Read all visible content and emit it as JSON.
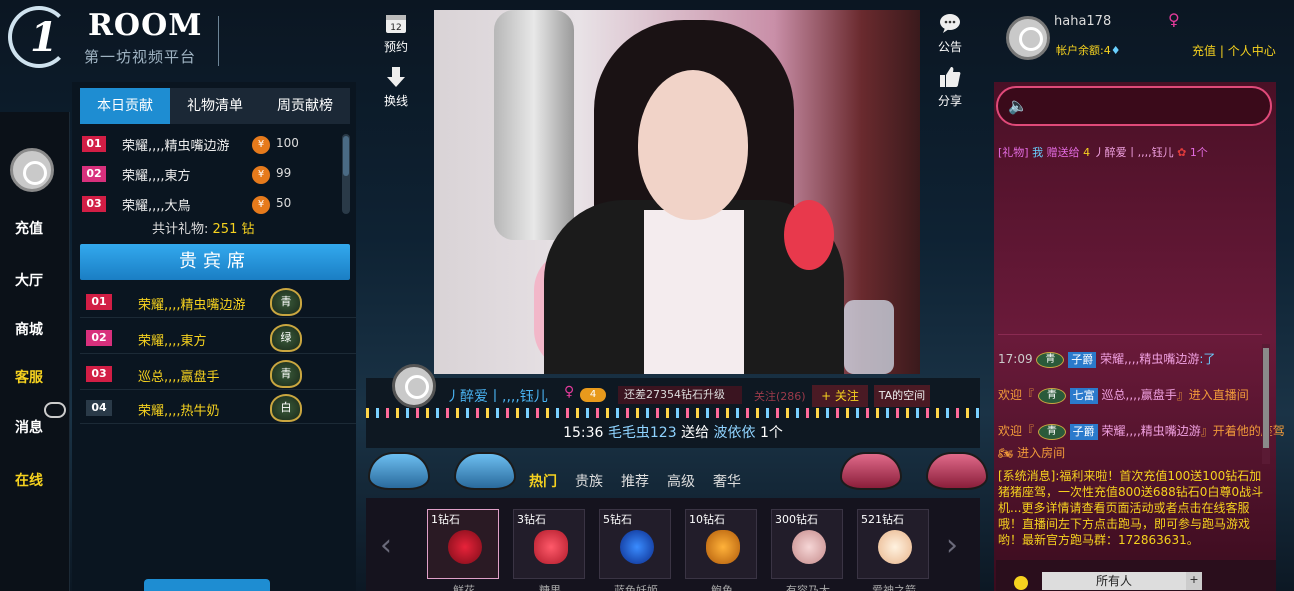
{
  "logo": {
    "mark": "1",
    "name": "ROOM",
    "subtitle": "第一坊视频平台"
  },
  "leftnav": {
    "items": [
      "充值",
      "大厅",
      "商城",
      "客服",
      "消息",
      "在线"
    ]
  },
  "contrib": {
    "tabs": [
      "本日贡献",
      "礼物清单",
      "周贡献榜"
    ],
    "rows": [
      {
        "rank": "01",
        "name": "荣耀,,,,精虫嘴边游",
        "value": "100"
      },
      {
        "rank": "02",
        "name": "荣耀,,,,東方",
        "value": "99"
      },
      {
        "rank": "03",
        "name": "荣耀,,,,大鳥",
        "value": "50"
      }
    ],
    "total_label": "共计礼物:",
    "total_value": "251 钻",
    "coin_symbol": "¥"
  },
  "vip": {
    "title": "贵宾席",
    "rows": [
      {
        "rank": "01",
        "name": "荣耀,,,,精虫嘴边游",
        "badge": "青"
      },
      {
        "rank": "02",
        "name": "荣耀,,,,東方",
        "badge": "绿"
      },
      {
        "rank": "03",
        "name": "巡总,,,,赢盘手",
        "badge": "青"
      },
      {
        "rank": "04",
        "name": "荣耀,,,,热牛奶",
        "badge": "白"
      }
    ]
  },
  "toolbar": {
    "reserve": "预约",
    "switch_line": "换线",
    "notice": "公告",
    "share": "分享",
    "reserve_day": "12"
  },
  "streamer": {
    "name": "丿醉爱丨,,,,钰儿",
    "level": "4",
    "progress_text": "还差27354钻石升级",
    "followers": "关注(286)",
    "follow_btn": "+ 关注",
    "space_btn": "TA的空间"
  },
  "ticker": {
    "time": "15:36",
    "sender": "毛毛虫123",
    "verb": "送给",
    "receiver": "波依依",
    "count": "1个"
  },
  "gift_tabs": [
    "热门",
    "贵族",
    "推荐",
    "高级",
    "奢华"
  ],
  "gifts": [
    {
      "price": "1钻石",
      "name": "鲜花"
    },
    {
      "price": "3钻石",
      "name": "糖果"
    },
    {
      "price": "5钻石",
      "name": "蓝色妖姬"
    },
    {
      "price": "10钻石",
      "name": "鲍鱼"
    },
    {
      "price": "300钻石",
      "name": "有容乃大"
    },
    {
      "price": "521钻石",
      "name": "爱神之箭"
    }
  ],
  "user": {
    "name": "haha178",
    "balance_label": "帐户余额:",
    "balance_value": "4",
    "recharge": "充值",
    "divider": "|",
    "center": "个人中心"
  },
  "chat": {
    "gift_msg": {
      "tag": "[礼物]",
      "me": "我",
      "verb": "赠送给",
      "level": "4",
      "target": "丿醉爱丨,,,,钰儿",
      "count": "1个"
    },
    "lines": [
      {
        "prefix": "17:09",
        "badge": "青",
        "tag": "子爵",
        "name": "荣耀,,,,精虫嘴边游",
        "suffix": ":了"
      },
      {
        "prefix": "欢迎『",
        "badge": "青",
        "tag": "七富",
        "name": "巡总,,,,赢盘手",
        "suffix": "』进入直播间"
      },
      {
        "prefix": "欢迎『",
        "badge": "青",
        "tag": "子爵",
        "name": "荣耀,,,,精虫嘴边游",
        "suffix": "』开着他的座驾",
        "suffix2": "进入房间"
      }
    ],
    "system": "[系统消息]:福利来啦！首次充值100送100钻石加猪猪座驾，一次性充值800送688钻石0白尊0战斗机...更多详情请查看页面活动或者点击在线客服哦！直播间左下方点击跑马，即可参与跑马游戏哟！最新官方跑马群：172863631。",
    "recipient": "所有人",
    "plus": "+"
  },
  "colors": {
    "accent": "#1e8dd2",
    "gold": "#f6d21f",
    "pink": "#e23b9a"
  }
}
